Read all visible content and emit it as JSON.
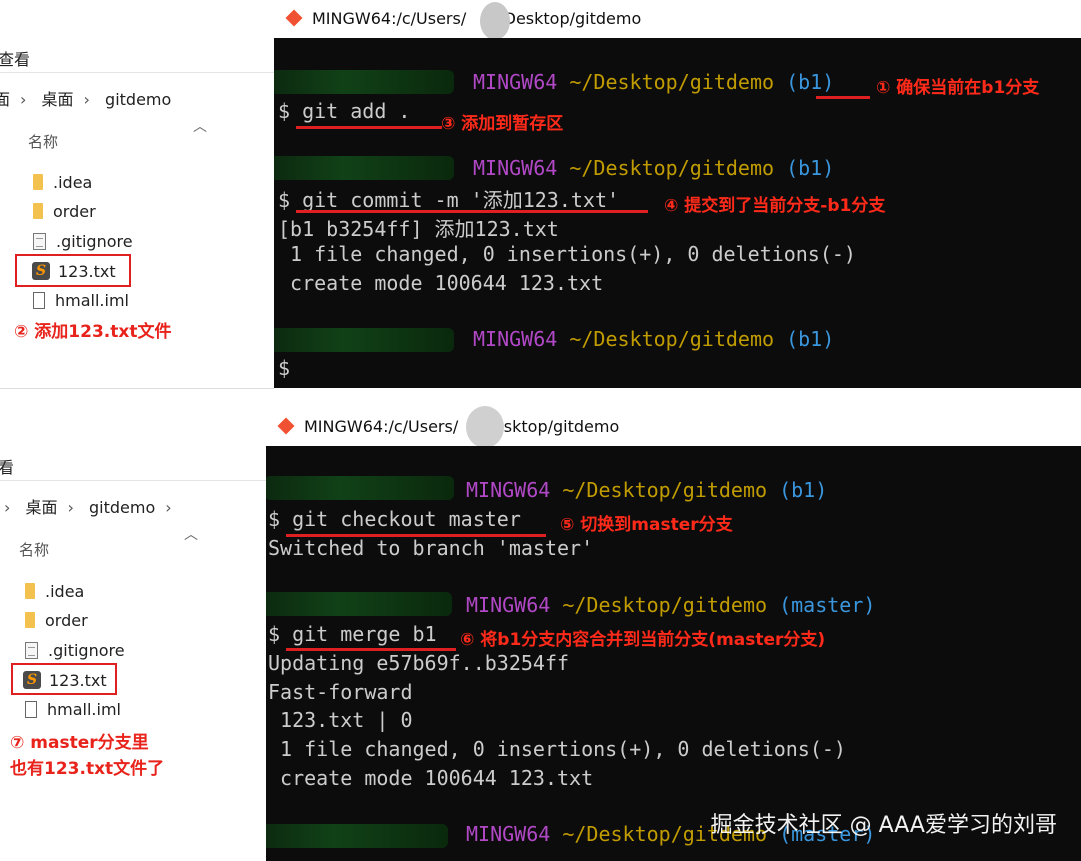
{
  "top": {
    "explorer": {
      "menu": "查看",
      "crumb": [
        "面",
        "桌面",
        "gitdemo"
      ],
      "col_header": "名称",
      "files": [
        {
          "name": ".idea",
          "icon": "folder-icon"
        },
        {
          "name": "order",
          "icon": "folder-icon"
        },
        {
          "name": ".gitignore",
          "icon": "text-file-icon"
        },
        {
          "name": "123.txt",
          "icon": "sublime-file-icon"
        },
        {
          "name": "hmall.iml",
          "icon": "iml-file-icon"
        }
      ],
      "annotation": "② 添加123.txt文件"
    },
    "terminal": {
      "title_prefix": "MINGW64:/c/Users/",
      "title_suffix": "/Desktop/gitdemo",
      "prompts": [
        {
          "host": "MINGW64",
          "path": "~/Desktop/gitdemo",
          "branch": "(b1)"
        },
        {
          "host": "MINGW64",
          "path": "~/Desktop/gitdemo",
          "branch": "(b1)"
        },
        {
          "host": "MINGW64",
          "path": "~/Desktop/gitdemo",
          "branch": "(b1)"
        }
      ],
      "cmd_add": "$ git add .",
      "cmd_commit": "$ git commit -m '添加123.txt'",
      "out_commit": [
        "[b1 b3254ff] 添加123.txt",
        " 1 file changed, 0 insertions(+), 0 deletions(-)",
        " create mode 100644 123.txt"
      ],
      "last_prompt": "$",
      "annotations": {
        "a1": "① 确保当前在b1分支",
        "a3": "③ 添加到暂存区",
        "a4": "④ 提交到了当前分支-b1分支"
      }
    }
  },
  "bottom": {
    "explorer": {
      "menu": "看",
      "crumb": [
        "桌面",
        "gitdemo"
      ],
      "col_header": "名称",
      "files": [
        {
          "name": ".idea",
          "icon": "folder-icon"
        },
        {
          "name": "order",
          "icon": "folder-icon"
        },
        {
          "name": ".gitignore",
          "icon": "text-file-icon"
        },
        {
          "name": "123.txt",
          "icon": "sublime-file-icon"
        },
        {
          "name": "hmall.iml",
          "icon": "iml-file-icon"
        }
      ],
      "annotation_l1": "⑦ master分支里",
      "annotation_l2": "也有123.txt文件了"
    },
    "terminal": {
      "title_prefix": "MINGW64:/c/Users/",
      "title_suffix": "/Desktop/gitdemo",
      "prompts": [
        {
          "host": "MINGW64",
          "path": "~/Desktop/gitdemo",
          "branch": "(b1)"
        },
        {
          "host": "MINGW64",
          "path": "~/Desktop/gitdemo",
          "branch": "(master)"
        },
        {
          "host": "MINGW64",
          "path": "~/Desktop/gitdemo",
          "branch": "(master)"
        }
      ],
      "cmd_checkout": "$ git checkout master",
      "out_checkout": "Switched to branch 'master'",
      "cmd_merge": "$ git merge b1",
      "out_merge": [
        "Updating e57b69f..b3254ff",
        "Fast-forward",
        " 123.txt | 0",
        " 1 file changed, 0 insertions(+), 0 deletions(-)",
        " create mode 100644 123.txt"
      ],
      "annotations": {
        "a5": "⑤ 切换到master分支",
        "a6": "⑥ 将b1分支内容合并到当前分支(master分支)"
      }
    }
  },
  "watermark": "掘金技术社区 @ AAA爱学习的刘哥"
}
